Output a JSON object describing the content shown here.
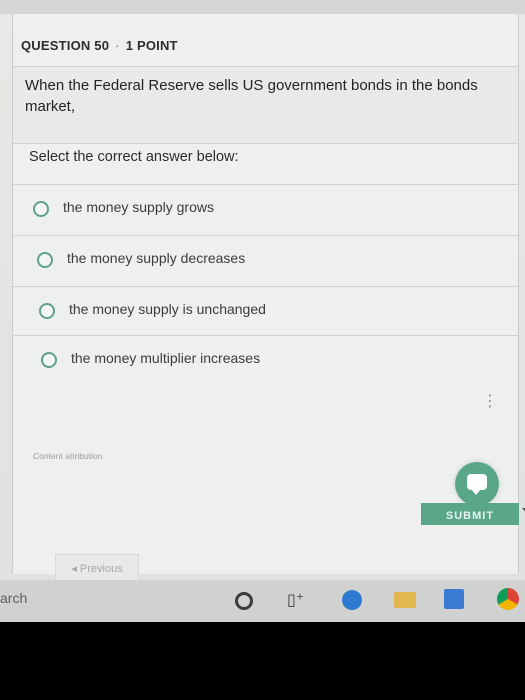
{
  "question": {
    "number_label": "QUESTION 50",
    "separator": "·",
    "points_label": "1 POINT",
    "text": "When the Federal Reserve sells US government bonds in the bonds market,"
  },
  "prompt": "Select the correct answer below:",
  "options": [
    {
      "label": "the money supply grows"
    },
    {
      "label": "the money supply decreases"
    },
    {
      "label": "the money supply is unchanged"
    },
    {
      "label": "the money multiplier increases"
    }
  ],
  "more_menu": "⋮",
  "attribution": "Content attribution",
  "submit_label": "SUBMIT",
  "previous_label": "◂ Previous",
  "taskbar": {
    "search_stub": "arch",
    "icons": [
      "cortana-icon",
      "task-view-icon",
      "edge-icon",
      "file-explorer-icon",
      "store-icon",
      "chrome-icon"
    ]
  },
  "colors": {
    "accent": "#5aa688",
    "background": "#e8eae8",
    "taskbar": "#cfd2d0"
  }
}
